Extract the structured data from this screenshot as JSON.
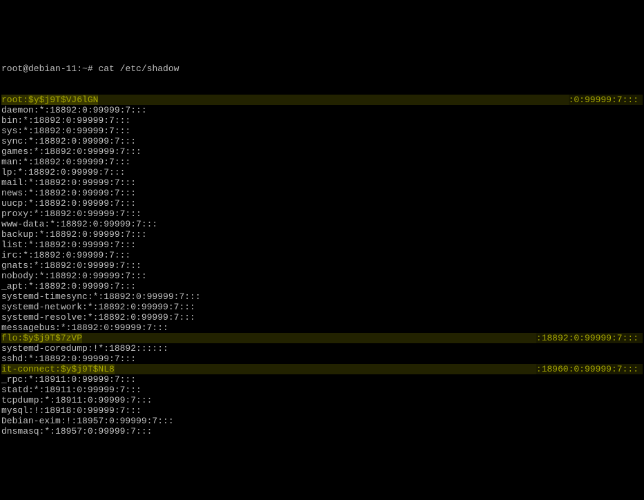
{
  "prompt": "root@debian-11:~# ",
  "command": "cat /etc/shadow",
  "lines": [
    {
      "type": "hl",
      "prefix": "root:",
      "hash": "$y$j9T$VJ6lGN",
      "suffix": ":0:99999:7:::"
    },
    {
      "type": "plain",
      "text": "daemon:*:18892:0:99999:7:::"
    },
    {
      "type": "plain",
      "text": "bin:*:18892:0:99999:7:::"
    },
    {
      "type": "plain",
      "text": "sys:*:18892:0:99999:7:::"
    },
    {
      "type": "plain",
      "text": "sync:*:18892:0:99999:7:::"
    },
    {
      "type": "plain",
      "text": "games:*:18892:0:99999:7:::"
    },
    {
      "type": "plain",
      "text": "man:*:18892:0:99999:7:::"
    },
    {
      "type": "plain",
      "text": "lp:*:18892:0:99999:7:::"
    },
    {
      "type": "plain",
      "text": "mail:*:18892:0:99999:7:::"
    },
    {
      "type": "plain",
      "text": "news:*:18892:0:99999:7:::"
    },
    {
      "type": "plain",
      "text": "uucp:*:18892:0:99999:7:::"
    },
    {
      "type": "plain",
      "text": "proxy:*:18892:0:99999:7:::"
    },
    {
      "type": "plain",
      "text": "www-data:*:18892:0:99999:7:::"
    },
    {
      "type": "plain",
      "text": "backup:*:18892:0:99999:7:::"
    },
    {
      "type": "plain",
      "text": "list:*:18892:0:99999:7:::"
    },
    {
      "type": "plain",
      "text": "irc:*:18892:0:99999:7:::"
    },
    {
      "type": "plain",
      "text": "gnats:*:18892:0:99999:7:::"
    },
    {
      "type": "plain",
      "text": "nobody:*:18892:0:99999:7:::"
    },
    {
      "type": "plain",
      "text": "_apt:*:18892:0:99999:7:::"
    },
    {
      "type": "plain",
      "text": "systemd-timesync:*:18892:0:99999:7:::"
    },
    {
      "type": "plain",
      "text": "systemd-network:*:18892:0:99999:7:::"
    },
    {
      "type": "plain",
      "text": "systemd-resolve:*:18892:0:99999:7:::"
    },
    {
      "type": "plain",
      "text": "messagebus:*:18892:0:99999:7:::"
    },
    {
      "type": "hl",
      "prefix": "flo:",
      "hash": "$y$j9T$7zVP",
      "suffix": ":18892:0:99999:7:::"
    },
    {
      "type": "plain",
      "text": "systemd-coredump:!*:18892::::::"
    },
    {
      "type": "plain",
      "text": "sshd:*:18892:0:99999:7:::"
    },
    {
      "type": "hl",
      "prefix": "it-connect:",
      "hash": "$y$j9T$NL8",
      "suffix": ":18960:0:99999:7:::"
    },
    {
      "type": "plain",
      "text": "_rpc:*:18911:0:99999:7:::"
    },
    {
      "type": "plain",
      "text": "statd:*:18911:0:99999:7:::"
    },
    {
      "type": "plain",
      "text": "tcpdump:*:18911:0:99999:7:::"
    },
    {
      "type": "plain",
      "text": "mysql:!:18918:0:99999:7:::"
    },
    {
      "type": "plain",
      "text": "Debian-exim:!:18957:0:99999:7:::"
    },
    {
      "type": "plain",
      "text": "dnsmasq:*:18957:0:99999:7:::"
    }
  ],
  "hl_mask_widths": {
    "root": 631,
    "flo": 578,
    "it-connect": 541
  }
}
